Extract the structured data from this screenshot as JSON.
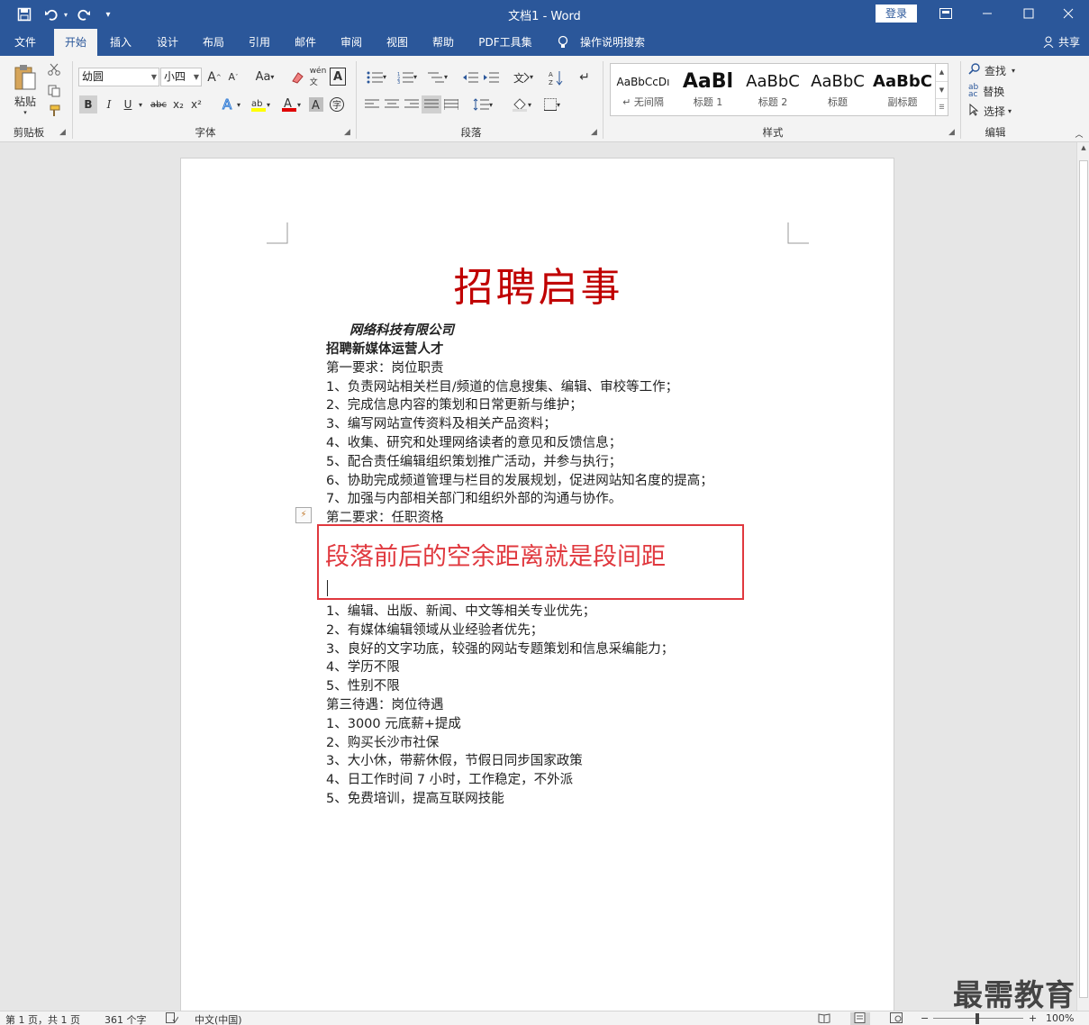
{
  "titlebar": {
    "title": "文档1 - Word",
    "login": "登录",
    "save_icon": "save-icon",
    "undo_icon": "undo-icon",
    "redo_icon": "redo-icon"
  },
  "tabs": [
    "文件",
    "开始",
    "插入",
    "设计",
    "布局",
    "引用",
    "邮件",
    "审阅",
    "视图",
    "帮助",
    "PDF工具集",
    "操作说明搜索"
  ],
  "share": "共享",
  "ribbon": {
    "clipboard": {
      "label": "剪贴板",
      "paste": "粘贴"
    },
    "font": {
      "label": "字体",
      "name": "幼圆",
      "size": "小四",
      "bold": "B",
      "italic": "I",
      "underline": "U",
      "strike": "abc",
      "sub": "x₂",
      "sup": "x²",
      "grow": "A",
      "shrink": "A",
      "case": "Aa"
    },
    "paragraph": {
      "label": "段落"
    },
    "styles": {
      "label": "样式",
      "items": [
        {
          "sample": "AaBbCcDı",
          "name": "↵ 无间隔"
        },
        {
          "sample": "AaBl",
          "name": "标题 1"
        },
        {
          "sample": "AaBbC",
          "name": "标题 2"
        },
        {
          "sample": "AaBbC",
          "name": "标题"
        },
        {
          "sample": "AaBbC",
          "name": "副标题"
        }
      ]
    },
    "editing": {
      "label": "编辑",
      "find": "查找",
      "replace": "替换",
      "select": "选择"
    }
  },
  "document": {
    "title": "招聘启事",
    "company": "网络科技有限公司",
    "position": "招聘新媒体运营人才",
    "section1": "第一要求：岗位职责",
    "duties": [
      "1、负责网站相关栏目/频道的信息搜集、编辑、审校等工作；",
      "2、完成信息内容的策划和日常更新与维护；",
      "3、编写网站宣传资料及相关产品资料；",
      "4、收集、研究和处理网络读者的意见和反馈信息；",
      "5、配合责任编辑组织策划推广活动，并参与执行；",
      "6、协助完成频道管理与栏目的发展规划，促进网站知名度的提高；",
      "7、加强与内部相关部门和组织外部的沟通与协作。"
    ],
    "section2": "第二要求：任职资格",
    "annotation": "段落前后的空余距离就是段间距",
    "qualifications": [
      "1、编辑、出版、新闻、中文等相关专业优先；",
      "2、有媒体编辑领域从业经验者优先；",
      "3、良好的文字功底，较强的网站专题策划和信息采编能力；",
      "4、学历不限",
      "5、性别不限"
    ],
    "section3": "第三待遇：岗位待遇",
    "benefits": [
      "1、3000 元底薪+提成",
      "2、购买长沙市社保",
      "3、大小休，带薪休假，节假日同步国家政策",
      "4、日工作时间 7 小时，工作稳定，不外派",
      "5、免费培训，提高互联网技能"
    ]
  },
  "watermark": "最需教育",
  "statusbar": {
    "page": "第 1 页，共 1 页",
    "words": "361 个字",
    "lang": "中文(中国)",
    "zoom": "100%"
  }
}
